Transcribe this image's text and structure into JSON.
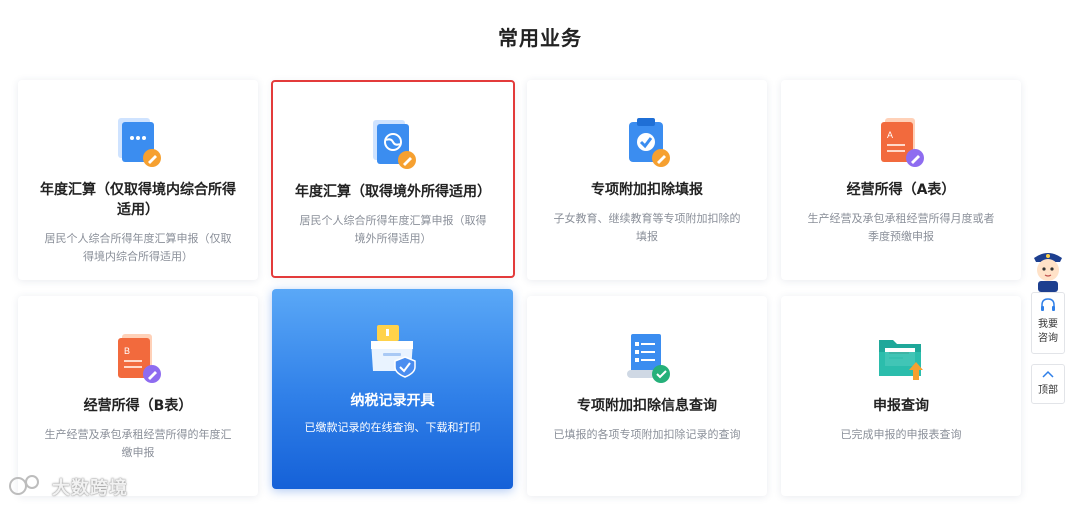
{
  "section_title": "常用业务",
  "cards": [
    {
      "name": "年度汇算（仅取得境内综合所得适用）",
      "desc": "居民个人综合所得年度汇算申报（仅取得境内综合所得适用）",
      "icon": "document-pen-icon"
    },
    {
      "name": "年度汇算（取得境外所得适用）",
      "desc": "居民个人综合所得年度汇算申报（取得境外所得适用）",
      "icon": "globe-document-icon"
    },
    {
      "name": "专项附加扣除填报",
      "desc": "子女教育、继续教育等专项附加扣除的填报",
      "icon": "clipboard-check-icon"
    },
    {
      "name": "经营所得（A表）",
      "desc": "生产经营及承包承租经营所得月度或者季度预缴申报",
      "icon": "form-a-icon"
    },
    {
      "name": "经营所得（B表）",
      "desc": "生产经营及承包承租经营所得的年度汇缴申报",
      "icon": "form-b-icon"
    },
    {
      "name": "纳税记录开具",
      "desc": "已缴款记录的在线查询、下载和打印",
      "icon": "archive-box-shield-icon"
    },
    {
      "name": "专项附加扣除信息查询",
      "desc": "已填报的各项专项附加扣除记录的查询",
      "icon": "scroll-list-check-icon"
    },
    {
      "name": "申报查询",
      "desc": "已完成申报的申报表查询",
      "icon": "folder-upload-icon"
    }
  ],
  "side": {
    "consult_label": "我要咨询",
    "consult_line1": "我要",
    "consult_line2": "咨询",
    "top_label": "顶部"
  },
  "watermark": "大数跨境",
  "colors": {
    "accent": "#2f7fe8",
    "selected_border": "#e33b3b",
    "orange": "#f6a030",
    "purple": "#8e6cf0"
  }
}
